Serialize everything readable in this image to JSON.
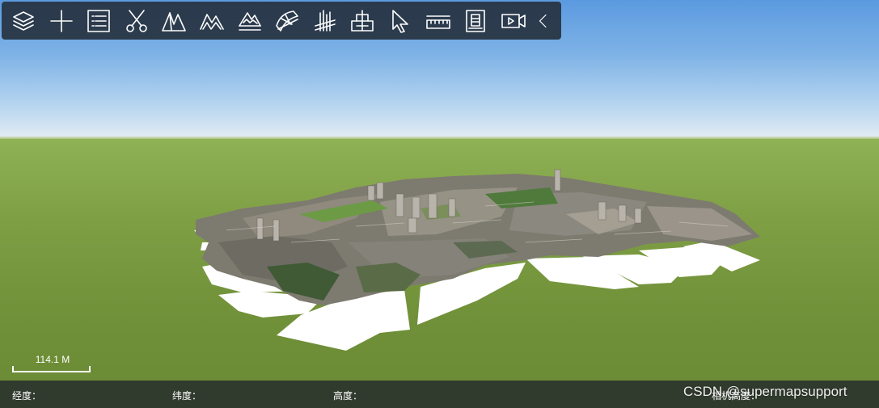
{
  "toolbar": {
    "tools": [
      {
        "icon": "layers-icon"
      },
      {
        "icon": "plus-icon"
      },
      {
        "icon": "list-icon"
      },
      {
        "icon": "scissors-icon"
      },
      {
        "icon": "terrain-icon"
      },
      {
        "icon": "terrain-contour-icon"
      },
      {
        "icon": "terrain-flood-icon"
      },
      {
        "icon": "slope-aspect-icon"
      },
      {
        "icon": "building-height-icon"
      },
      {
        "icon": "profile-icon"
      },
      {
        "icon": "cursor-icon"
      },
      {
        "icon": "ruler-icon"
      },
      {
        "icon": "document-icon"
      },
      {
        "icon": "video-icon"
      },
      {
        "icon": "chevron-left-icon"
      }
    ]
  },
  "scale": {
    "label": "114.1  M"
  },
  "status": {
    "longitude_label": "经度：",
    "latitude_label": "纬度：",
    "height_label": "高度：",
    "camera_height_label": "相机高度："
  },
  "watermark": "CSDN @supermapsupport",
  "colors": {
    "sky_top": "#5b9ae0",
    "ground": "#7f9f45",
    "toolbar_bg": "#232c38"
  }
}
